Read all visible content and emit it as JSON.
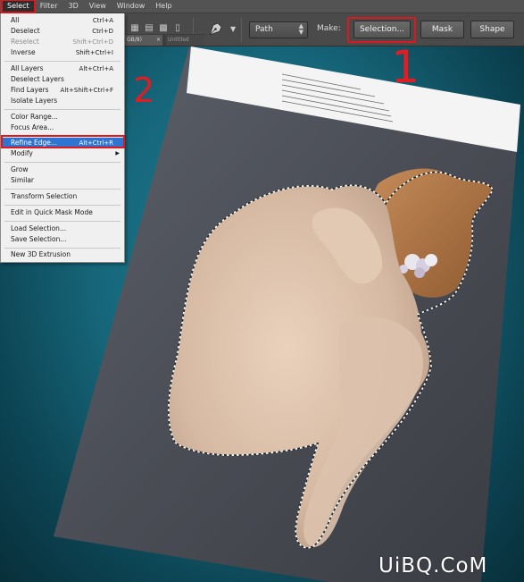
{
  "menubar": {
    "items": [
      "Select",
      "Filter",
      "3D",
      "View",
      "Window",
      "Help"
    ],
    "active": "Select"
  },
  "options_bar": {
    "path_select": "Path",
    "make_label": "Make:",
    "selection_button": "Selection...",
    "mask_button": "Mask",
    "shape_button": "Shape"
  },
  "doc_tabs": [
    "GB/8)",
    "Untitled"
  ],
  "select_menu": {
    "items": [
      {
        "label": "All",
        "shortcut": "Ctrl+A"
      },
      {
        "label": "Deselect",
        "shortcut": "Ctrl+D"
      },
      {
        "label": "Reselect",
        "shortcut": "Shift+Ctrl+D",
        "disabled": true
      },
      {
        "label": "Inverse",
        "shortcut": "Shift+Ctrl+I"
      },
      {
        "label": "All Layers",
        "shortcut": "Alt+Ctrl+A"
      },
      {
        "label": "Deselect Layers",
        "shortcut": ""
      },
      {
        "label": "Find Layers",
        "shortcut": "Alt+Shift+Ctrl+F"
      },
      {
        "label": "Isolate Layers",
        "shortcut": ""
      },
      {
        "label": "Color Range...",
        "shortcut": ""
      },
      {
        "label": "Focus Area...",
        "shortcut": ""
      },
      {
        "label": "Refine Edge...",
        "shortcut": "Alt+Ctrl+R",
        "highlighted": true
      },
      {
        "label": "Modify",
        "shortcut": "",
        "submenu": true
      },
      {
        "label": "Grow",
        "shortcut": ""
      },
      {
        "label": "Similar",
        "shortcut": ""
      },
      {
        "label": "Transform Selection",
        "shortcut": ""
      },
      {
        "label": "Edit in Quick Mask Mode",
        "shortcut": ""
      },
      {
        "label": "Load Selection...",
        "shortcut": ""
      },
      {
        "label": "Save Selection...",
        "shortcut": ""
      },
      {
        "label": "New 3D Extrusion",
        "shortcut": ""
      }
    ]
  },
  "annotations": {
    "one": "1",
    "two": "2"
  },
  "watermark": "UiBQ.CoM",
  "colors": {
    "highlight_red": "#e0171d",
    "menu_highlight": "#2f74d0",
    "panel": "#4a4a4a"
  }
}
